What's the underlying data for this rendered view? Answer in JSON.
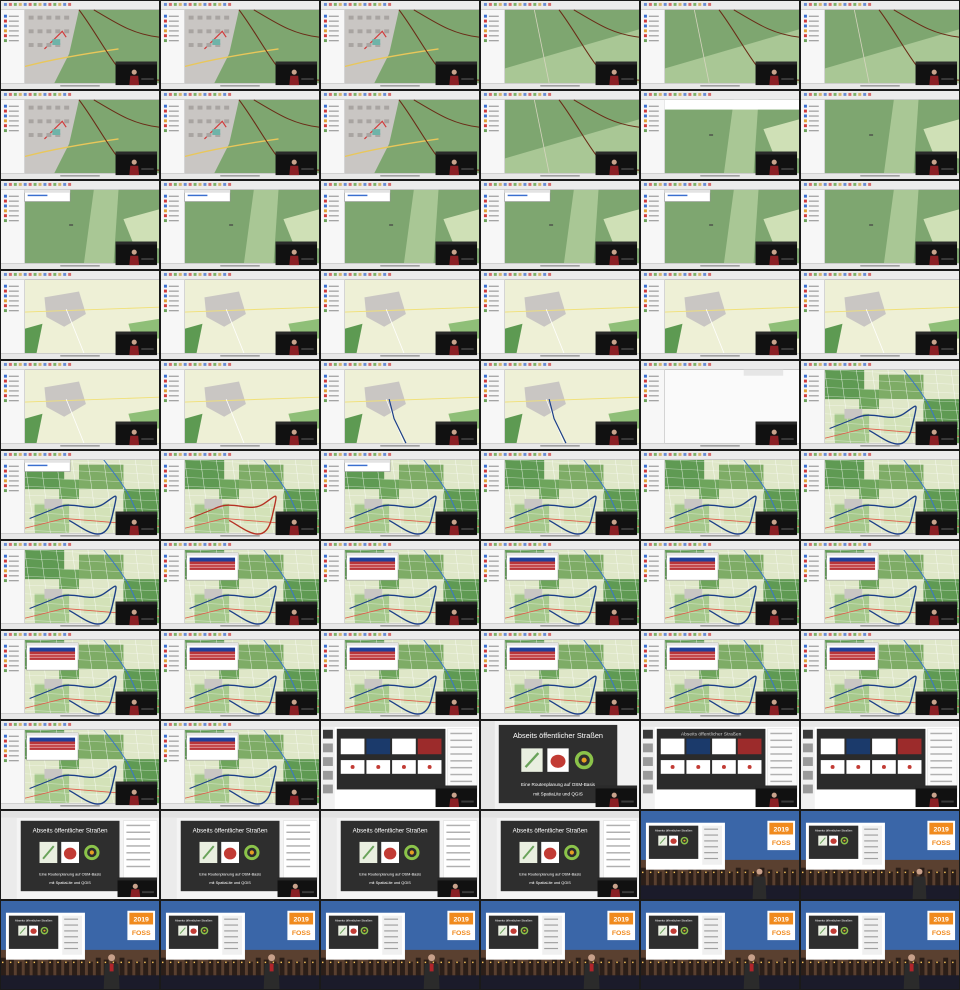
{
  "contact_sheet": {
    "columns": 6,
    "rows": 11,
    "thumbnails": [
      {
        "scene": "qgis-map",
        "map": "town",
        "track": "brown"
      },
      {
        "scene": "qgis-map",
        "map": "town",
        "track": "brown"
      },
      {
        "scene": "qgis-map",
        "map": "town",
        "track": "brown"
      },
      {
        "scene": "qgis-map",
        "map": "fields",
        "track": "brown"
      },
      {
        "scene": "qgis-map",
        "map": "fields",
        "track": "brown"
      },
      {
        "scene": "qgis-map",
        "map": "fields",
        "track": "brown"
      },
      {
        "scene": "qgis-map",
        "map": "town",
        "track": "brown"
      },
      {
        "scene": "qgis-map",
        "map": "town",
        "track": "brown"
      },
      {
        "scene": "qgis-map",
        "map": "town",
        "track": "brown"
      },
      {
        "scene": "qgis-map",
        "map": "fields",
        "track": "brown"
      },
      {
        "scene": "qgis-map",
        "map": "meadow",
        "loading": true
      },
      {
        "scene": "qgis-map",
        "map": "meadow"
      },
      {
        "scene": "qgis-map",
        "map": "meadow",
        "dialog": "small"
      },
      {
        "scene": "qgis-map",
        "map": "meadow",
        "dialog": "small"
      },
      {
        "scene": "qgis-map",
        "map": "meadow",
        "dialog": "small"
      },
      {
        "scene": "qgis-map",
        "map": "meadow",
        "dialog": "small"
      },
      {
        "scene": "qgis-map",
        "map": "meadow",
        "dialog": "small"
      },
      {
        "scene": "qgis-map",
        "map": "meadow"
      },
      {
        "scene": "qgis-map",
        "map": "village"
      },
      {
        "scene": "qgis-map",
        "map": "village"
      },
      {
        "scene": "qgis-map",
        "map": "village"
      },
      {
        "scene": "qgis-map",
        "map": "village"
      },
      {
        "scene": "qgis-map",
        "map": "village"
      },
      {
        "scene": "qgis-map",
        "map": "village"
      },
      {
        "scene": "qgis-map",
        "map": "village"
      },
      {
        "scene": "qgis-map",
        "map": "village"
      },
      {
        "scene": "qgis-map",
        "map": "village",
        "track": "blue"
      },
      {
        "scene": "qgis-map",
        "map": "village",
        "track": "blue"
      },
      {
        "scene": "qgis-map",
        "map": "blank"
      },
      {
        "scene": "qgis-map",
        "map": "region",
        "track": "blue"
      },
      {
        "scene": "qgis-map",
        "map": "region",
        "track": "blue",
        "dialog": "small"
      },
      {
        "scene": "qgis-map",
        "map": "region",
        "track": "red"
      },
      {
        "scene": "qgis-map",
        "map": "region",
        "track": "blue",
        "dialog": "small"
      },
      {
        "scene": "qgis-map",
        "map": "region",
        "track": "blue"
      },
      {
        "scene": "qgis-map",
        "map": "region",
        "track": "blue"
      },
      {
        "scene": "qgis-map",
        "map": "region",
        "track": "blue"
      },
      {
        "scene": "qgis-map",
        "map": "region",
        "track": "blue"
      },
      {
        "scene": "qgis-map",
        "map": "region",
        "track": "blue",
        "dialog": "table"
      },
      {
        "scene": "qgis-map",
        "map": "region",
        "track": "blue",
        "dialog": "table"
      },
      {
        "scene": "qgis-map",
        "map": "region",
        "track": "blue",
        "dialog": "table"
      },
      {
        "scene": "qgis-map",
        "map": "region",
        "track": "blue",
        "dialog": "table"
      },
      {
        "scene": "qgis-map",
        "map": "region",
        "track": "blue",
        "dialog": "table"
      },
      {
        "scene": "qgis-map",
        "map": "region",
        "track": "blue",
        "dialog": "table"
      },
      {
        "scene": "qgis-map",
        "map": "region",
        "track": "blue",
        "dialog": "table"
      },
      {
        "scene": "qgis-map",
        "map": "region",
        "track": "blue",
        "dialog": "table"
      },
      {
        "scene": "qgis-map",
        "map": "region",
        "track": "blue",
        "dialog": "table"
      },
      {
        "scene": "qgis-map",
        "map": "region",
        "track": "blue",
        "dialog": "table"
      },
      {
        "scene": "qgis-map",
        "map": "region",
        "track": "blue",
        "dialog": "table"
      },
      {
        "scene": "qgis-map",
        "map": "region",
        "track": "blue",
        "dialog": "table"
      },
      {
        "scene": "qgis-map",
        "map": "region",
        "track": "blue",
        "dialog": "table"
      },
      {
        "scene": "slide-overview"
      },
      {
        "scene": "title-slide"
      },
      {
        "scene": "slide-overview",
        "banner": "Abseits öffentlicher Straßen"
      },
      {
        "scene": "slide-overview"
      },
      {
        "scene": "title-slide-editor"
      },
      {
        "scene": "title-slide-editor"
      },
      {
        "scene": "title-slide-editor"
      },
      {
        "scene": "title-slide-editor"
      },
      {
        "scene": "stage"
      },
      {
        "scene": "stage"
      },
      {
        "scene": "stage-speaker"
      },
      {
        "scene": "stage-speaker"
      },
      {
        "scene": "stage-speaker"
      },
      {
        "scene": "stage-speaker"
      },
      {
        "scene": "stage-speaker"
      },
      {
        "scene": "stage-speaker"
      }
    ]
  },
  "slide": {
    "title": "Abseits öffentlicher Straßen",
    "subtitle_line1": "Eine Routenplanung auf OSM-Basis",
    "subtitle_line2": "mit SpatiaLite und QGIS"
  },
  "conference": {
    "logo_top": "2019",
    "logo_bottom": "FOSS"
  },
  "colors": {
    "map_green": "#7ea670",
    "map_green_light": "#a9c795",
    "map_pale": "#eef0d6",
    "town_gray": "#c9c6c3",
    "track_brown": "#6a2a16",
    "track_blue": "#1b3f87",
    "track_red": "#b53123",
    "table_header": "#1f3f9a",
    "table_row": "#b8363a",
    "panel": "#f7f7f7",
    "slide_bg": "#2e2e2e",
    "stage_sky": "#3a66a8",
    "stage_city": "#5a4030",
    "logo_orange": "#f08a1e"
  }
}
